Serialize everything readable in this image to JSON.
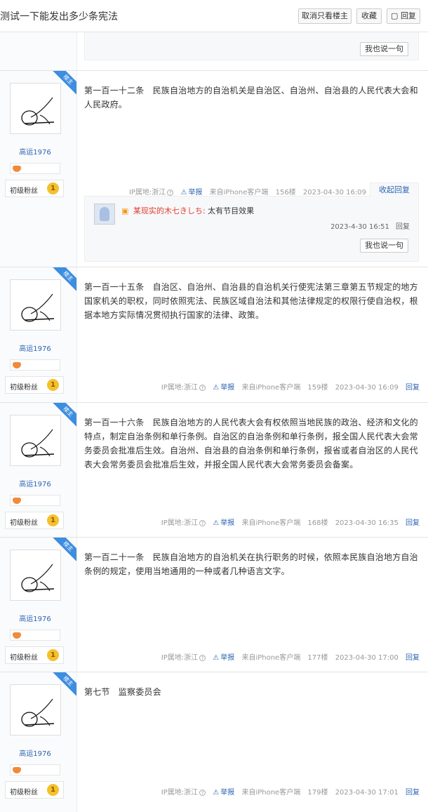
{
  "thread": {
    "title": "测试一下能发出多少条宪法",
    "buttons": {
      "cancel_only_lz": "取消只看楼主",
      "favorite": "收藏",
      "reply": "回复"
    }
  },
  "say_button": "我也说一句",
  "author": {
    "name": "高运1976",
    "badge": "楼主",
    "level": "初级粉丝",
    "level_num": "1"
  },
  "meta_labels": {
    "ip": "IP属地:浙江",
    "report": "举报",
    "source": "来自iPhone客户端",
    "reply": "回复",
    "collapse": "收起回复"
  },
  "posts": [
    {
      "text": "第一百一十二条　民族自治地方的自治机关是自治区、自治州、自治县的人民代表大会和人民政府。",
      "floor": "156楼",
      "time": "2023-04-30 16:09"
    },
    {
      "text": "第一百一十五条　自治区、自治州、自治县的自治机关行使宪法第三章第五节规定的地方国家机关的职权，同时依照宪法、民族区域自治法和其他法律规定的权限行使自治权，根据本地方实际情况贯彻执行国家的法律、政策。",
      "floor": "159楼",
      "time": "2023-04-30 16:09"
    },
    {
      "text": "第一百一十六条　民族自治地方的人民代表大会有权依照当地民族的政治、经济和文化的特点，制定自治条例和单行条例。自治区的自治条例和单行条例，报全国人民代表大会常务委员会批准后生效。自治州、自治县的自治条例和单行条例，报省或者自治区的人民代表大会常务委员会批准后生效，并报全国人民代表大会常务委员会备案。",
      "floor": "168楼",
      "time": "2023-04-30 16:35"
    },
    {
      "text": "第一百二十一条　民族自治地方的自治机关在执行职务的时候，依照本民族自治地方自治条例的规定，使用当地通用的一种或者几种语言文字。",
      "floor": "177楼",
      "time": "2023-04-30 17:00"
    },
    {
      "text": "第七节　监察委员会",
      "floor": "179楼",
      "time": "2023-04-30 17:01"
    }
  ],
  "comment": {
    "user": "某现实的木七きしち",
    "text": "太有节目效果",
    "time": "2023-4-30 16:51",
    "reply": "回复"
  }
}
